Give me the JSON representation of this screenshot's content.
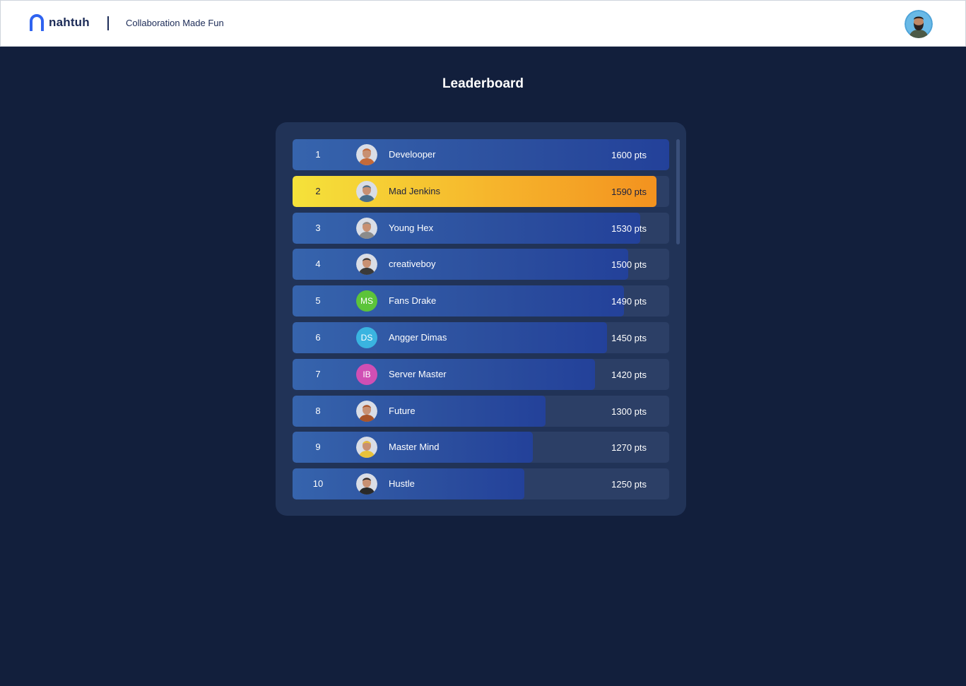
{
  "header": {
    "brand": "nahtuh",
    "tagline": "Collaboration Made Fun",
    "logo_color": "#2f63f0",
    "user_avatar_icon": "user-profile-photo"
  },
  "page": {
    "title": "Leaderboard"
  },
  "colors": {
    "background": "#121f3c",
    "card": "#213357",
    "bar": "#2c4f9e",
    "highlight_start": "#f5e23a",
    "highlight_end": "#f3921f"
  },
  "leaderboard": {
    "max_points": 1600,
    "rows": [
      {
        "rank": "1",
        "name": "Develooper",
        "points": 1600,
        "points_label": "1600 pts",
        "avatar": "photo",
        "avatar_color": "#c46a3a",
        "highlight": false
      },
      {
        "rank": "2",
        "name": "Mad Jenkins",
        "points": 1590,
        "points_label": "1590 pts",
        "avatar": "photo",
        "avatar_color": "#4a6e8a",
        "highlight": true
      },
      {
        "rank": "3",
        "name": "Young Hex",
        "points": 1530,
        "points_label": "1530 pts",
        "avatar": "photo",
        "avatar_color": "#8b8b8b",
        "highlight": false
      },
      {
        "rank": "4",
        "name": "creativeboy",
        "points": 1500,
        "points_label": "1500 pts",
        "avatar": "photo",
        "avatar_color": "#3a3a3a",
        "highlight": false
      },
      {
        "rank": "5",
        "name": "Fans Drake",
        "points": 1490,
        "points_label": "1490 pts",
        "avatar": "initials",
        "initials": "MS",
        "avatar_color": "#5cc43a",
        "highlight": false
      },
      {
        "rank": "6",
        "name": "Angger Dimas",
        "points": 1450,
        "points_label": "1450 pts",
        "avatar": "initials",
        "initials": "DS",
        "avatar_color": "#3ab4e0",
        "highlight": false
      },
      {
        "rank": "7",
        "name": "Server Master",
        "points": 1420,
        "points_label": "1420 pts",
        "avatar": "initials",
        "initials": "IB",
        "avatar_color": "#d04fb4",
        "highlight": false
      },
      {
        "rank": "8",
        "name": "Future",
        "points": 1300,
        "points_label": "1300 pts",
        "avatar": "photo",
        "avatar_color": "#a8542a",
        "highlight": false
      },
      {
        "rank": "9",
        "name": "Master Mind",
        "points": 1270,
        "points_label": "1270 pts",
        "avatar": "photo",
        "avatar_color": "#e8c23a",
        "highlight": false
      },
      {
        "rank": "10",
        "name": "Hustle",
        "points": 1250,
        "points_label": "1250 pts",
        "avatar": "photo",
        "avatar_color": "#2a2a2a",
        "highlight": false
      }
    ]
  }
}
